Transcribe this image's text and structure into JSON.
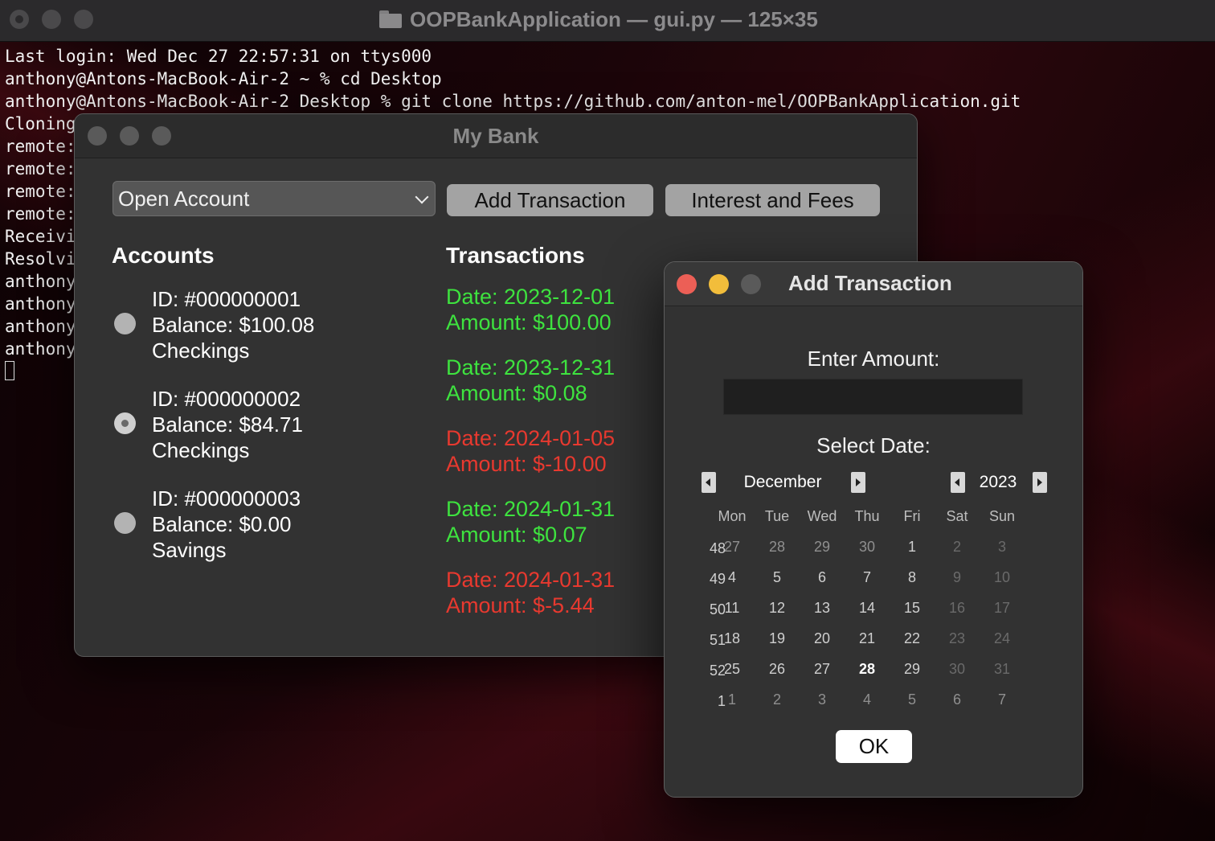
{
  "terminal": {
    "title": "OOPBankApplication — gui.py — 125×35",
    "lines": [
      "Last login: Wed Dec 27 22:57:31 on ttys000",
      "anthony@Antons-MacBook-Air-2 ~ % cd Desktop",
      "anthony@Antons-MacBook-Air-2 Desktop % git clone https://github.com/anton-mel/OOPBankApplication.git",
      "Cloning",
      "remote:",
      "remote:",
      "remote:",
      "remote:",
      "Receivi",
      "Resolvi",
      "anthony",
      "anthony",
      "anthony",
      "anthony"
    ]
  },
  "bank": {
    "title": "My Bank",
    "open_account_label": "Open Account",
    "add_transaction_label": "Add Transaction",
    "interest_fees_label": "Interest and Fees",
    "accounts_heading": "Accounts",
    "transactions_heading": "Transactions",
    "accounts": [
      {
        "id": "ID: #000000001",
        "balance": "Balance: $100.08",
        "type": "Checkings",
        "selected": false
      },
      {
        "id": "ID: #000000002",
        "balance": "Balance: $84.71",
        "type": "Checkings",
        "selected": true
      },
      {
        "id": "ID: #000000003",
        "balance": "Balance: $0.00",
        "type": "Savings",
        "selected": false
      }
    ],
    "transactions": [
      {
        "date": "Date: 2023-12-01",
        "amount": "Amount: $100.00",
        "positive": true
      },
      {
        "date": "Date: 2023-12-31",
        "amount": "Amount: $0.08",
        "positive": true
      },
      {
        "date": "Date: 2024-01-05",
        "amount": "Amount: $-10.00",
        "positive": false
      },
      {
        "date": "Date: 2024-01-31",
        "amount": "Amount: $0.07",
        "positive": true
      },
      {
        "date": "Date: 2024-01-31",
        "amount": "Amount: $-5.44",
        "positive": false
      }
    ],
    "colors": {
      "positive": "#3ee33f",
      "negative": "#e8392f"
    }
  },
  "dialog": {
    "title": "Add Transaction",
    "enter_amount_label": "Enter Amount:",
    "amount_value": "",
    "select_date_label": "Select Date:",
    "month": "December",
    "year": "2023",
    "weekdays": [
      "Mon",
      "Tue",
      "Wed",
      "Thu",
      "Fri",
      "Sat",
      "Sun"
    ],
    "weeks": [
      {
        "week": "48",
        "days": [
          "27",
          "28",
          "29",
          "30",
          "1",
          "2",
          "3"
        ]
      },
      {
        "week": "49",
        "days": [
          "4",
          "5",
          "6",
          "7",
          "8",
          "9",
          "10"
        ]
      },
      {
        "week": "50",
        "days": [
          "11",
          "12",
          "13",
          "14",
          "15",
          "16",
          "17"
        ]
      },
      {
        "week": "51",
        "days": [
          "18",
          "19",
          "20",
          "21",
          "22",
          "23",
          "24"
        ]
      },
      {
        "week": "52",
        "days": [
          "25",
          "26",
          "27",
          "28",
          "29",
          "30",
          "31"
        ]
      },
      {
        "week": "1",
        "days": [
          "1",
          "2",
          "3",
          "4",
          "5",
          "6",
          "7"
        ]
      }
    ],
    "selected_day": "28",
    "ok_label": "OK"
  }
}
